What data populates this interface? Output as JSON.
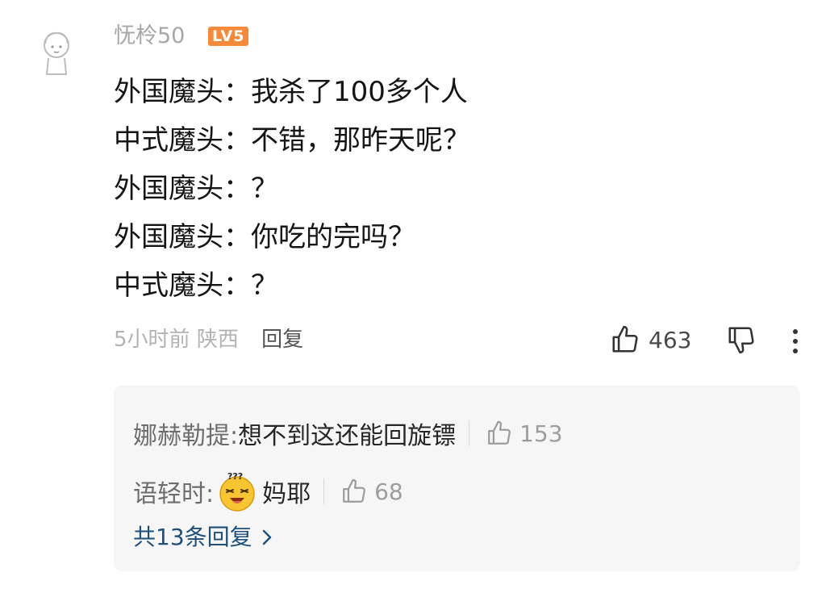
{
  "comment": {
    "username": "怃柃50",
    "level_badge": "LV5",
    "lines": [
      "外国魔头：我杀了100多个人",
      "中式魔头：不错，那昨天呢？",
      "外国魔头：？",
      "外国魔头：你吃的完吗？",
      "中式魔头：？"
    ],
    "time": "5小时前",
    "location": "陕西",
    "reply_label": "回复",
    "like_count": "463",
    "icons": {
      "like": "thumbs-up-icon",
      "dislike": "thumbs-down-icon",
      "more": "more-vertical-icon",
      "avatar": "user-avatar"
    }
  },
  "replies": {
    "items": [
      {
        "name": "娜赫勒提:",
        "text": "想不到这还能回旋镖",
        "like_count": "153"
      },
      {
        "name": "语轻时:",
        "emoji": "confused-face-emoji",
        "text": "妈耶",
        "like_count": "68"
      }
    ],
    "view_more_label": "共13条回复",
    "view_more_icon": "chevron-right-icon"
  },
  "colors": {
    "level_badge": "#f58b3a",
    "view_more_link": "#1f4f7b",
    "reply_box_bg": "#f6f6f6"
  }
}
